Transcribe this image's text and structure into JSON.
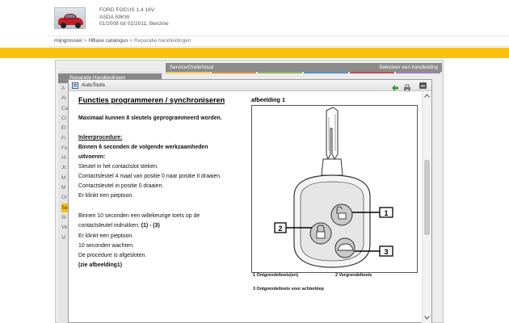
{
  "vehicle": {
    "model": "FORD FOCUS 1.4 16V.",
    "engine": "ASDA 59KW",
    "period": "01/2008 tot 01/2011, Benzine"
  },
  "breadcrumb": {
    "items": [
      "mijngrossier",
      "HBase catalogus",
      "Reparatie handleidingen"
    ],
    "separator": ">"
  },
  "background_app": {
    "left_header": "Reparatie Handleidingen",
    "right_header_left": "Service/Onderhoud",
    "right_header_right": "Selecteer een handleiding",
    "left_letters": [
      "A",
      "Al",
      "Ca",
      "Ci",
      "El",
      "Fi",
      "Fo",
      "Hi",
      "Jc",
      "M",
      "M",
      "Or",
      "Se",
      "Sl",
      "Ve",
      "Vi"
    ],
    "active_letter_index": 12
  },
  "modal": {
    "title": "AutoTools",
    "heading": "Functies programmeren / synchroniseren",
    "intro": "Maximaal kunnen 8 sleutels geprogrammeerd worden.",
    "procedure_label": "Inleerprocedure:",
    "step_heading": "Binnen 6 seconden de volgende werkzaamheden uitvoeren:",
    "step_heading_line1": "Binnen 6 seconden de volgende werkzaamheden",
    "step_heading_line2": "uitvoeren:",
    "steps1": [
      "Sleutel in het contactslot steken.",
      "Contactsleutel 4 maal van positie 0 naar positie II draaien.",
      "Contactsleutel in positie 0 draaien.",
      "Er klinkt een pieptoon."
    ],
    "steps2_line1": "Binnen 10 seconden een willekeurige toets op de",
    "steps2_line2_prefix": "contactsleutel indrukken.",
    "steps2_line2_ref": "(1) - (3)",
    "steps2": [
      "Er klinkt een pieptoon.",
      "10 seconden wachten.",
      "De procedure is afgesloten."
    ],
    "figure_ref": "(zie afbeelding1)",
    "figure_label": "afbeelding 1",
    "callouts": [
      "1",
      "2",
      "3"
    ],
    "legend": [
      "1 Ontgrendeltoets(en)",
      "2 Vergrendeltoets",
      "3 Ontgrendeltoets voor achterklep"
    ]
  },
  "colors": {
    "accent_yellow": "#fbc10f",
    "header_gray": "#8c8c8c",
    "stripes": [
      "#f2c94c",
      "#e08a3c",
      "#8fb65a",
      "#5b8fc7",
      "#c0504d",
      "#9b7fbf"
    ]
  }
}
